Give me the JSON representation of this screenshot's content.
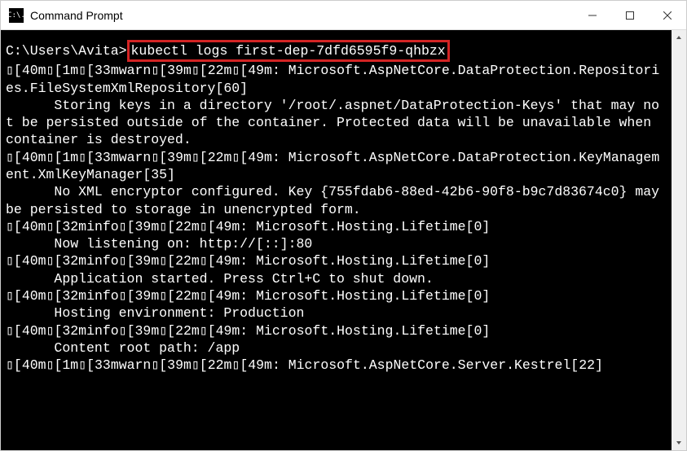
{
  "window": {
    "title": "Command Prompt",
    "icon_text": "C:\\."
  },
  "colors": {
    "highlight_border": "#d32424",
    "terminal_bg": "#000000",
    "terminal_fg": "#ffffff"
  },
  "prompt": "C:\\Users\\Avita>",
  "command": "kubectl logs first-dep-7dfd6595f9-qhbzx",
  "lines": [
    "▯[40m▯[1m▯[33mwarn▯[39m▯[22m▯[49m: Microsoft.AspNetCore.DataProtection.Repositories.FileSystemXmlRepository[60]",
    "      Storing keys in a directory '/root/.aspnet/DataProtection-Keys' that may not be persisted outside of the container. Protected data will be unavailable when container is destroyed.",
    "▯[40m▯[1m▯[33mwarn▯[39m▯[22m▯[49m: Microsoft.AspNetCore.DataProtection.KeyManagement.XmlKeyManager[35]",
    "      No XML encryptor configured. Key {755fdab6-88ed-42b6-90f8-b9c7d83674c0} may be persisted to storage in unencrypted form.",
    "▯[40m▯[32minfo▯[39m▯[22m▯[49m: Microsoft.Hosting.Lifetime[0]",
    "      Now listening on: http://[::]:80",
    "▯[40m▯[32minfo▯[39m▯[22m▯[49m: Microsoft.Hosting.Lifetime[0]",
    "      Application started. Press Ctrl+C to shut down.",
    "▯[40m▯[32minfo▯[39m▯[22m▯[49m: Microsoft.Hosting.Lifetime[0]",
    "      Hosting environment: Production",
    "▯[40m▯[32minfo▯[39m▯[22m▯[49m: Microsoft.Hosting.Lifetime[0]",
    "      Content root path: /app",
    "▯[40m▯[1m▯[33mwarn▯[39m▯[22m▯[49m: Microsoft.AspNetCore.Server.Kestrel[22]"
  ]
}
